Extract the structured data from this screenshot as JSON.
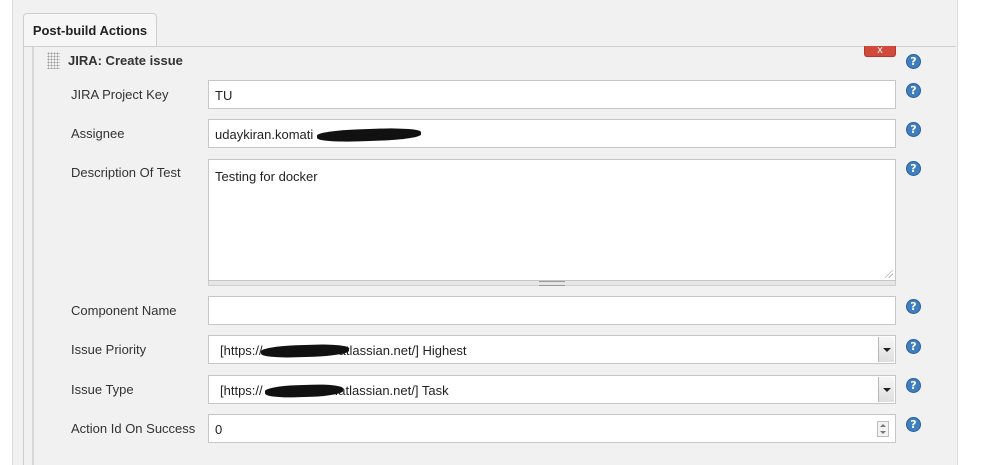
{
  "tab": {
    "label": "Post-build Actions"
  },
  "plugin": {
    "title": "JIRA: Create issue",
    "delete_label": "x"
  },
  "help_glyph": "?",
  "fields": {
    "project_key": {
      "label": "JIRA Project Key",
      "value": "TU"
    },
    "assignee": {
      "label": "Assignee",
      "value": "udaykiran.komati"
    },
    "description": {
      "label": "Description Of Test",
      "value": "Testing for docker"
    },
    "component": {
      "label": "Component Name",
      "value": ""
    },
    "priority": {
      "label": "Issue Priority",
      "prefix": "[https://",
      "suffix": "atlassian.net/] Highest"
    },
    "issue_type": {
      "label": "Issue Type",
      "prefix": "[https://",
      "suffix": ".atlassian.net/] Task"
    },
    "action_id": {
      "label": "Action Id On Success",
      "value": "0"
    }
  },
  "colors": {
    "accent_help": "#3f7fc0",
    "delete": "#d24a3c",
    "panel": "#f1f1f1"
  }
}
